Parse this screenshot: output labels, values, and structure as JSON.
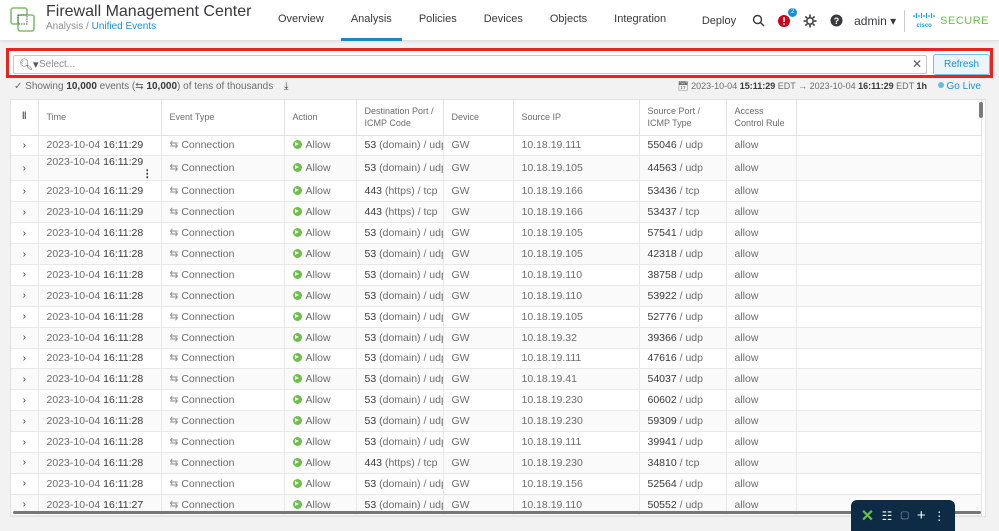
{
  "header": {
    "app_title": "Firewall Management Center",
    "breadcrumb_parent": "Analysis",
    "breadcrumb_sep": " / ",
    "breadcrumb_current": "Unified Events",
    "nav": [
      "Overview",
      "Analysis",
      "Policies",
      "Devices",
      "Objects",
      "Integration"
    ],
    "active_nav": "Analysis",
    "deploy": "Deploy",
    "notification_count": "2",
    "user": "admin ▾",
    "brand_logo": "cisco",
    "brand_text": "SECURE"
  },
  "filter": {
    "placeholder": "Select...",
    "value": "",
    "refresh_label": "Refresh"
  },
  "status": {
    "prefix": "Showing ",
    "events_count": "10,000",
    "events_word": " events (",
    "sync_count": "10,000",
    "suffix": ") of tens of thousands",
    "range_start_date": "2023-10-04 ",
    "range_start_time": "15:11:29",
    "tz1": " EDT → ",
    "range_end_date": "2023-10-04 ",
    "range_end_time": "16:11:29",
    "tz2": " EDT ",
    "duration": "1h",
    "go_live": "Go Live"
  },
  "colors": {
    "accent": "#1f87c3",
    "highlight_border": "#e8241b",
    "allow_green": "#6cc04a",
    "brand_green": "#6cc04a"
  },
  "table": {
    "columns": [
      "Time",
      "Event Type",
      "Action",
      "Destination Port / ICMP Code",
      "Device",
      "Source IP",
      "Source Port / ICMP Type",
      "Access Control Rule"
    ],
    "rows": [
      {
        "date": "2023-10-04 ",
        "time": "16:11:29",
        "type": "Connection",
        "action": "Allow",
        "dport": "53",
        "dsvc": " (domain) / udp",
        "device": "GW",
        "src_ip": "10.18.19.111",
        "sport": "55046",
        "sproto": " / udp",
        "rule": "allow"
      },
      {
        "date": "2023-10-04 ",
        "time": "16:11:29",
        "type": "Connection",
        "action": "Allow",
        "dport": "53",
        "dsvc": " (domain) / udp",
        "device": "GW",
        "src_ip": "10.18.19.105",
        "sport": "44563",
        "sproto": " / udp",
        "rule": "allow"
      },
      {
        "date": "2023-10-04 ",
        "time": "16:11:29",
        "type": "Connection",
        "action": "Allow",
        "dport": "443",
        "dsvc": " (https) / tcp",
        "device": "GW",
        "src_ip": "10.18.19.166",
        "sport": "53436",
        "sproto": " / tcp",
        "rule": "allow"
      },
      {
        "date": "2023-10-04 ",
        "time": "16:11:29",
        "type": "Connection",
        "action": "Allow",
        "dport": "443",
        "dsvc": " (https) / tcp",
        "device": "GW",
        "src_ip": "10.18.19.166",
        "sport": "53437",
        "sproto": " / tcp",
        "rule": "allow"
      },
      {
        "date": "2023-10-04 ",
        "time": "16:11:28",
        "type": "Connection",
        "action": "Allow",
        "dport": "53",
        "dsvc": " (domain) / udp",
        "device": "GW",
        "src_ip": "10.18.19.105",
        "sport": "57541",
        "sproto": " / udp",
        "rule": "allow"
      },
      {
        "date": "2023-10-04 ",
        "time": "16:11:28",
        "type": "Connection",
        "action": "Allow",
        "dport": "53",
        "dsvc": " (domain) / udp",
        "device": "GW",
        "src_ip": "10.18.19.105",
        "sport": "42318",
        "sproto": " / udp",
        "rule": "allow"
      },
      {
        "date": "2023-10-04 ",
        "time": "16:11:28",
        "type": "Connection",
        "action": "Allow",
        "dport": "53",
        "dsvc": " (domain) / udp",
        "device": "GW",
        "src_ip": "10.18.19.110",
        "sport": "38758",
        "sproto": " / udp",
        "rule": "allow"
      },
      {
        "date": "2023-10-04 ",
        "time": "16:11:28",
        "type": "Connection",
        "action": "Allow",
        "dport": "53",
        "dsvc": " (domain) / udp",
        "device": "GW",
        "src_ip": "10.18.19.110",
        "sport": "53922",
        "sproto": " / udp",
        "rule": "allow"
      },
      {
        "date": "2023-10-04 ",
        "time": "16:11:28",
        "type": "Connection",
        "action": "Allow",
        "dport": "53",
        "dsvc": " (domain) / udp",
        "device": "GW",
        "src_ip": "10.18.19.105",
        "sport": "52776",
        "sproto": " / udp",
        "rule": "allow"
      },
      {
        "date": "2023-10-04 ",
        "time": "16:11:28",
        "type": "Connection",
        "action": "Allow",
        "dport": "53",
        "dsvc": " (domain) / udp",
        "device": "GW",
        "src_ip": "10.18.19.32",
        "sport": "39366",
        "sproto": " / udp",
        "rule": "allow"
      },
      {
        "date": "2023-10-04 ",
        "time": "16:11:28",
        "type": "Connection",
        "action": "Allow",
        "dport": "53",
        "dsvc": " (domain) / udp",
        "device": "GW",
        "src_ip": "10.18.19.111",
        "sport": "47616",
        "sproto": " / udp",
        "rule": "allow"
      },
      {
        "date": "2023-10-04 ",
        "time": "16:11:28",
        "type": "Connection",
        "action": "Allow",
        "dport": "53",
        "dsvc": " (domain) / udp",
        "device": "GW",
        "src_ip": "10.18.19.41",
        "sport": "54037",
        "sproto": " / udp",
        "rule": "allow"
      },
      {
        "date": "2023-10-04 ",
        "time": "16:11:28",
        "type": "Connection",
        "action": "Allow",
        "dport": "53",
        "dsvc": " (domain) / udp",
        "device": "GW",
        "src_ip": "10.18.19.230",
        "sport": "60602",
        "sproto": " / udp",
        "rule": "allow"
      },
      {
        "date": "2023-10-04 ",
        "time": "16:11:28",
        "type": "Connection",
        "action": "Allow",
        "dport": "53",
        "dsvc": " (domain) / udp",
        "device": "GW",
        "src_ip": "10.18.19.230",
        "sport": "59309",
        "sproto": " / udp",
        "rule": "allow"
      },
      {
        "date": "2023-10-04 ",
        "time": "16:11:28",
        "type": "Connection",
        "action": "Allow",
        "dport": "53",
        "dsvc": " (domain) / udp",
        "device": "GW",
        "src_ip": "10.18.19.111",
        "sport": "39941",
        "sproto": " / udp",
        "rule": "allow"
      },
      {
        "date": "2023-10-04 ",
        "time": "16:11:28",
        "type": "Connection",
        "action": "Allow",
        "dport": "443",
        "dsvc": " (https) / tcp",
        "device": "GW",
        "src_ip": "10.18.19.230",
        "sport": "34810",
        "sproto": " / tcp",
        "rule": "allow"
      },
      {
        "date": "2023-10-04 ",
        "time": "16:11:28",
        "type": "Connection",
        "action": "Allow",
        "dport": "53",
        "dsvc": " (domain) / udp",
        "device": "GW",
        "src_ip": "10.18.19.156",
        "sport": "52564",
        "sproto": " / udp",
        "rule": "allow"
      },
      {
        "date": "2023-10-04 ",
        "time": "16:11:27",
        "type": "Connection",
        "action": "Allow",
        "dport": "53",
        "dsvc": " (domain) / udp",
        "device": "GW",
        "src_ip": "10.18.19.110",
        "sport": "50552",
        "sproto": " / udp",
        "rule": "allow"
      }
    ]
  },
  "floating_toolbar": {
    "icons": [
      "close-x-icon",
      "apps-grid-icon",
      "window-search-icon",
      "plus-icon",
      "more-icon"
    ]
  }
}
